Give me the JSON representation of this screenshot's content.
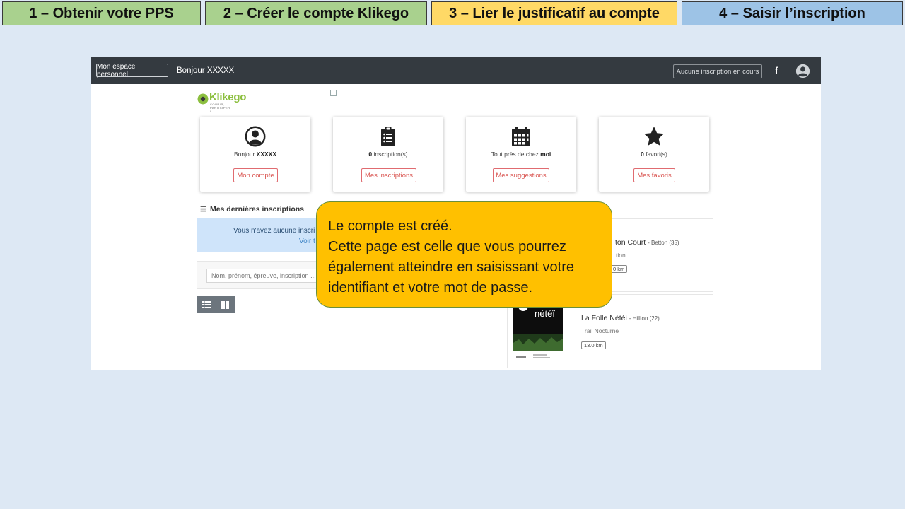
{
  "steps": [
    {
      "label": "1 – Obtenir votre PPS",
      "color": "#a9d18e"
    },
    {
      "label": "2 – Créer le compte Klikego",
      "color": "#a9d18e"
    },
    {
      "label": "3 – Lier le justificatif au compte",
      "color": "#ffd966"
    },
    {
      "label": "4 – Saisir l’inscription",
      "color": "#9dc3e6"
    }
  ],
  "topbar": {
    "espace_button": "Mon espace personnel",
    "greeting": "Bonjour XXXXX",
    "status_button": "Aucune inscription en cours",
    "facebook_icon": "f",
    "avatar_icon": "user-circle-icon"
  },
  "logo": {
    "name": "Klikego",
    "tagline": "COURIR, PARTICIPER !"
  },
  "cards": [
    {
      "icon": "user-circle-icon",
      "label_prefix": "Bonjour ",
      "label_bold": "XXXXX",
      "label_suffix": "",
      "button": "Mon compte"
    },
    {
      "icon": "clipboard-list-icon",
      "label_prefix": "",
      "label_bold": "0",
      "label_suffix": " inscription(s)",
      "button": "Mes inscriptions"
    },
    {
      "icon": "calendar-icon",
      "label_prefix": "Tout près de chez ",
      "label_bold": "moi",
      "label_suffix": "",
      "button": "Mes suggestions"
    },
    {
      "icon": "star-icon",
      "label_prefix": "",
      "label_bold": "0",
      "label_suffix": " favori(s)",
      "button": "Mes favoris"
    }
  ],
  "recent": {
    "title": "Mes dernières inscriptions",
    "alert_line1": "Vous n'avez aucune inscri",
    "alert_line2": "Voir t",
    "search_placeholder": "Nom, prénom, épreuve, inscription ..."
  },
  "events": [
    {
      "title": "ton Court",
      "location": "- Betton (35)",
      "type": "tion",
      "distance": "0 km"
    },
    {
      "title": "La Folle Nétéi",
      "location": "- Hillion (22)",
      "type": "Trail Nocturne",
      "distance": "13.0 km",
      "poster_text": "nétéï"
    }
  ],
  "callout": {
    "line1": "Le compte est créé.",
    "line2": "Cette page est celle que vous pourrez",
    "line3": "également atteindre en saisissant votre",
    "line4": "identifiant et votre mot de passe."
  }
}
